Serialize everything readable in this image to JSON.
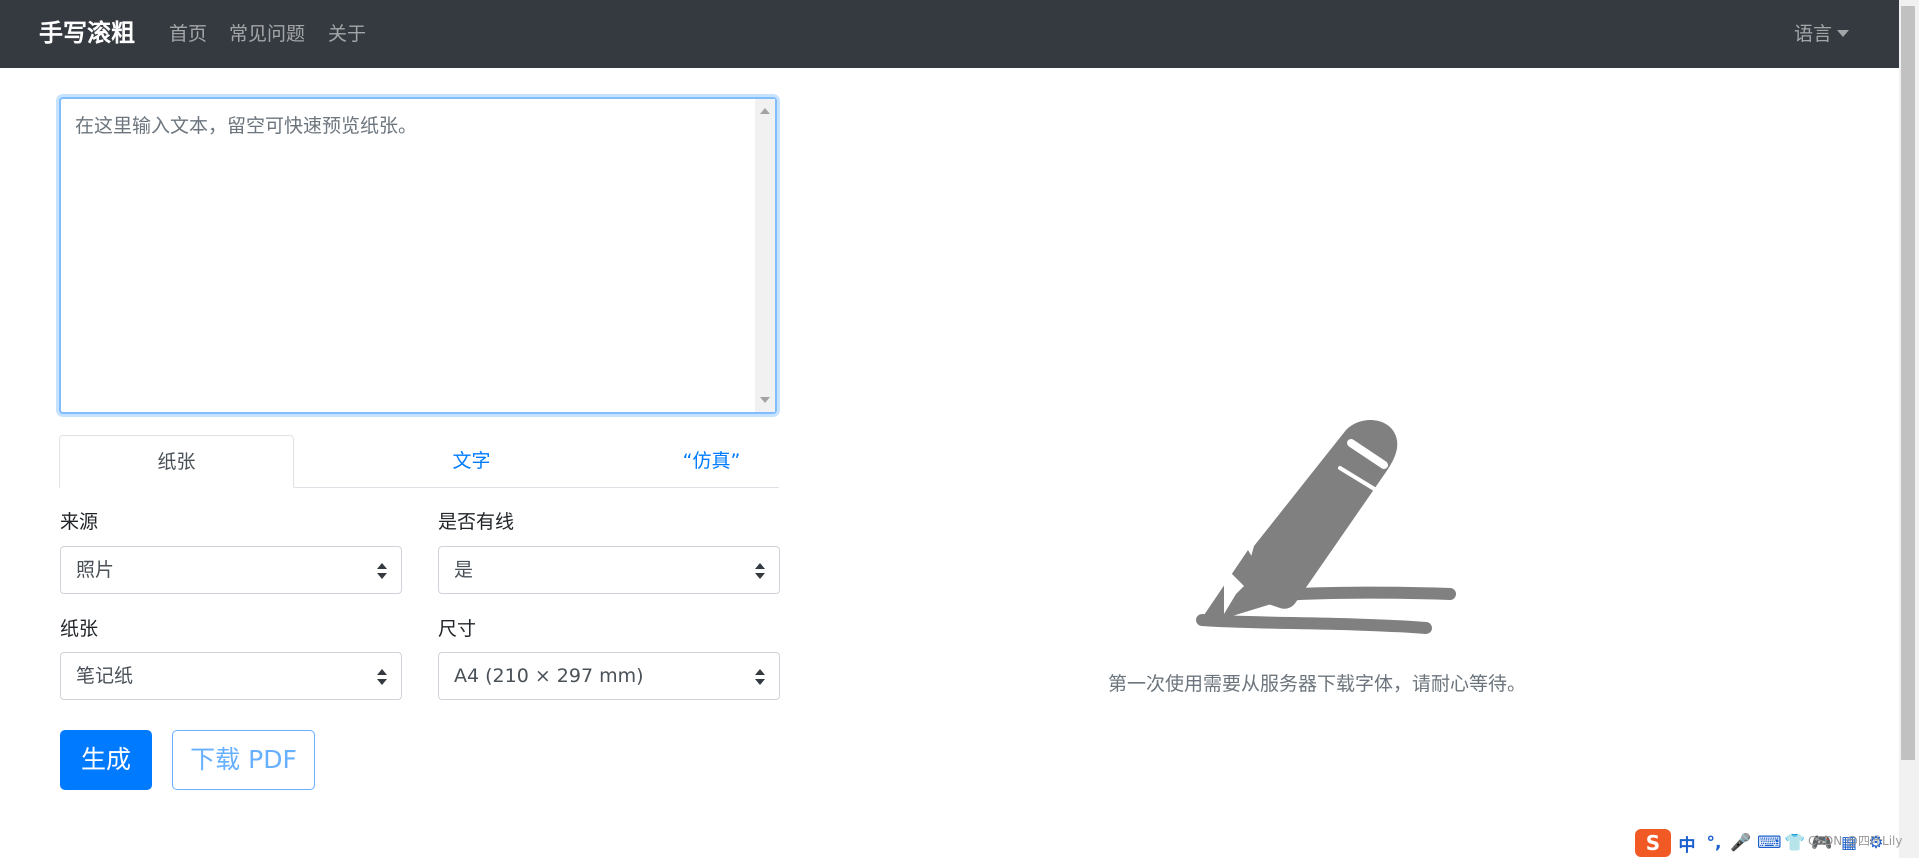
{
  "navbar": {
    "brand": "手写滚粗",
    "links": [
      "首页",
      "常见问题",
      "关于"
    ],
    "language": "语言"
  },
  "editor": {
    "placeholder": "在这里输入文本，留空可快速预览纸张。"
  },
  "tabs": [
    {
      "label": "纸张",
      "active": true
    },
    {
      "label": "文字",
      "active": false
    },
    {
      "label": "“仿真”",
      "active": false
    }
  ],
  "form": {
    "source": {
      "label": "来源",
      "value": "照片"
    },
    "lined": {
      "label": "是否有线",
      "value": "是"
    },
    "paper": {
      "label": "纸张",
      "value": "笔记纸"
    },
    "size": {
      "label": "尺寸",
      "value": "A4 (210 × 297 mm)"
    }
  },
  "buttons": {
    "generate": "生成",
    "download": "下载 PDF"
  },
  "preview": {
    "loading_text": "第一次使用需要从服务器下载字体，请耐心等待。",
    "illustration_icon": "pen-writing-icon"
  },
  "ime": {
    "logo": "S",
    "items": [
      "中",
      "°,",
      "🎤",
      "⌨",
      "👕",
      "🎮",
      "▦",
      "⚙"
    ]
  },
  "watermark": "CSDN @四叶Lily",
  "colors": {
    "navbar_bg": "#343a40",
    "primary": "#007bff",
    "illustration": "#808080"
  }
}
